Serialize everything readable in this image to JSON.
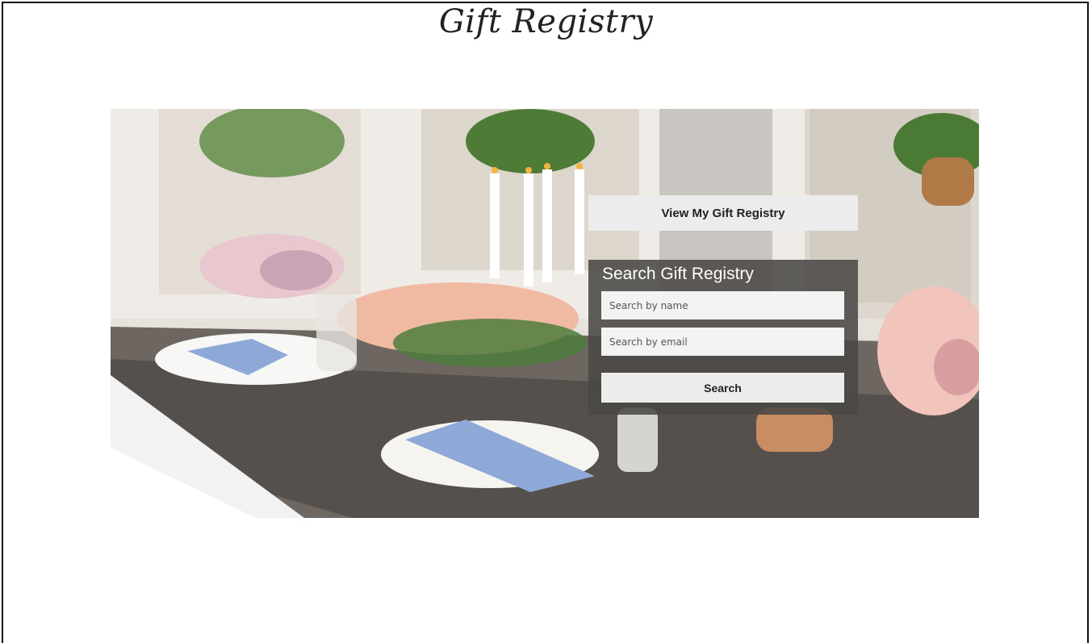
{
  "header": {
    "logo_text": "Gift Registry"
  },
  "hero": {
    "image_description_icon": "wedding-table-image"
  },
  "actions": {
    "view_registry_label": "View My Gift Registry"
  },
  "search": {
    "title": "Search Gift Registry",
    "name_placeholder": "Search by name",
    "email_placeholder": "Search by email",
    "name_value": "",
    "email_value": "",
    "button_label": "Search"
  },
  "colors": {
    "button_bg": "#ececec",
    "panel_bg": "#4a4846"
  }
}
